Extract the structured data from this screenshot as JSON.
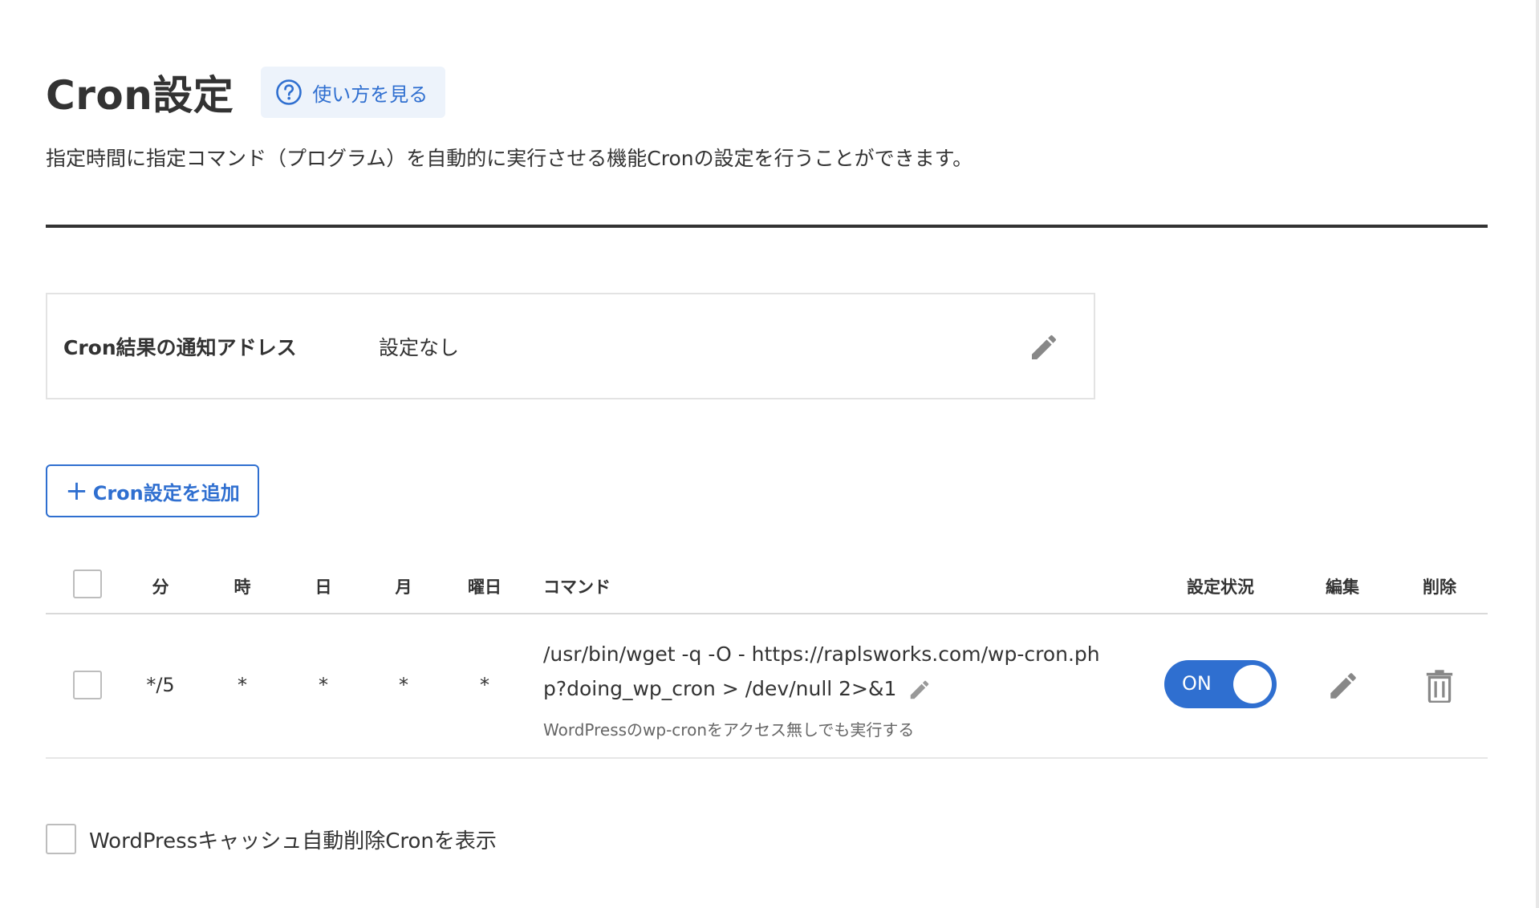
{
  "header": {
    "title": "Cron設定",
    "help_link": "使い方を見る",
    "description": "指定時間に指定コマンド（プログラム）を自動的に実行させる機能Cronの設定を行うことができます。"
  },
  "notify": {
    "label": "Cron結果の通知アドレス",
    "value": "設定なし"
  },
  "add_button": {
    "plus": "+",
    "label": "Cron設定を追加"
  },
  "table": {
    "columns": {
      "minute": "分",
      "hour": "時",
      "day": "日",
      "month": "月",
      "weekday": "曜日",
      "command": "コマンド",
      "status": "設定状況",
      "edit": "編集",
      "delete": "削除"
    },
    "rows": [
      {
        "minute": "*/5",
        "hour": "*",
        "day": "*",
        "month": "*",
        "weekday": "*",
        "command_line1": "/usr/bin/wget -q -O - https://raplsworks.com/wp-cron.ph",
        "command_line2": "p?doing_wp_cron > /dev/null 2>&1",
        "note": "WordPressのwp-cronをアクセス無しでも実行する",
        "status": "ON",
        "checked": false
      }
    ]
  },
  "footer": {
    "wp_cache_label": "WordPressキャッシュ自動削除Cronを表示"
  },
  "colors": {
    "accent": "#2f6fd0",
    "text": "#333333",
    "border": "#e3e3e3"
  },
  "icons": [
    "help-circle-icon",
    "pencil-icon",
    "trash-icon",
    "plus-icon"
  ]
}
